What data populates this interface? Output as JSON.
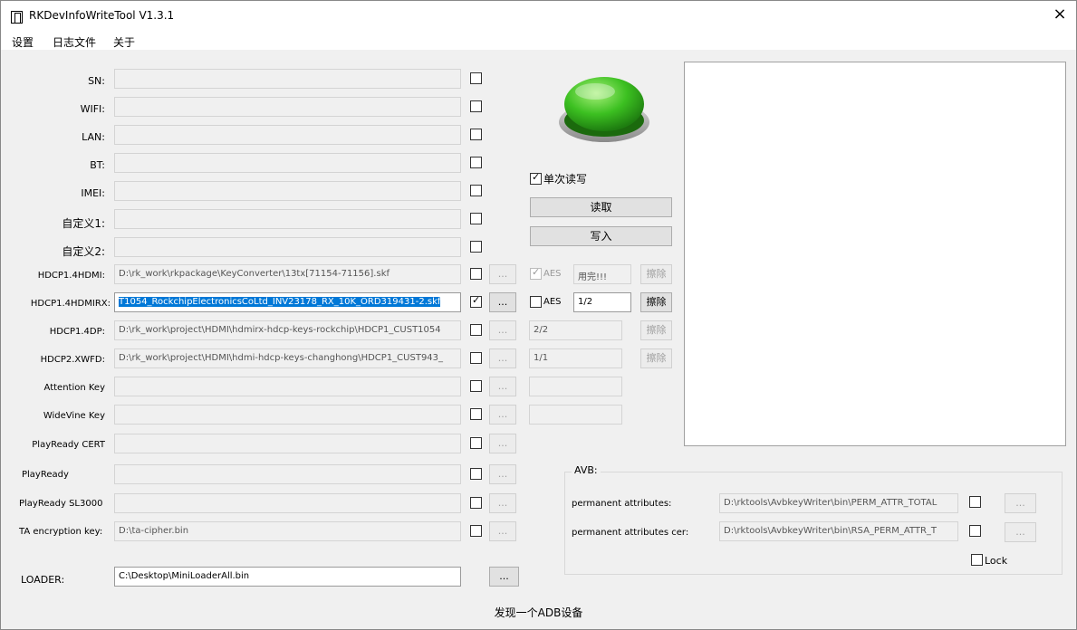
{
  "window": {
    "title": "RKDevInfoWriteTool V1.3.1",
    "close_label": "×"
  },
  "menu": {
    "settings": "设置",
    "log": "日志文件",
    "about": "关于"
  },
  "fields": {
    "sn": {
      "label": "SN:",
      "value": ""
    },
    "wifi": {
      "label": "WIFI:",
      "value": ""
    },
    "lan": {
      "label": "LAN:",
      "value": ""
    },
    "bt": {
      "label": "BT:",
      "value": ""
    },
    "imei": {
      "label": "IMEI:",
      "value": ""
    },
    "custom1": {
      "label": "自定义1:",
      "value": ""
    },
    "custom2": {
      "label": "自定义2:",
      "value": ""
    },
    "hdcp14hdmi": {
      "label": "HDCP1.4HDMI:",
      "value": "D:\\rk_work\\rkpackage\\KeyConverter\\13tx[71154-71156].skf"
    },
    "hdcp14hdmirx": {
      "label": "HDCP1.4HDMIRX:",
      "value": "T1054_RockchipElectronicsCoLtd_INV23178_RX_10K_ORD319431-2.skf"
    },
    "hdcp14dp": {
      "label": "HDCP1.4DP:",
      "value": "D:\\rk_work\\project\\HDMI\\hdmirx-hdcp-keys-rockchip\\HDCP1_CUST1054"
    },
    "hdcp2xwfd": {
      "label": "HDCP2.XWFD:",
      "value": "D:\\rk_work\\project\\HDMI\\hdmi-hdcp-keys-changhong\\HDCP1_CUST943_"
    },
    "attention": {
      "label": "Attention Key",
      "value": ""
    },
    "widevine": {
      "label": "WideVine Key",
      "value": ""
    },
    "playready_cert": {
      "label": "PlayReady CERT",
      "value": ""
    },
    "playready": {
      "label": "PlayReady",
      "value": ""
    },
    "playready_sl3000": {
      "label": "PlayReady SL3000",
      "value": ""
    },
    "ta_key": {
      "label": "TA encryption key:",
      "value": "D:\\ta-cipher.bin"
    },
    "loader": {
      "label": "LOADER:",
      "value": "C:\\Desktop\\MiniLoaderAll.bin"
    }
  },
  "browse_label": "...",
  "controls": {
    "single_rw": "单次读写",
    "read": "读取",
    "write": "写入"
  },
  "aes": {
    "row1": {
      "label": "AES",
      "status": "用完!!!",
      "erase": "擦除"
    },
    "row2": {
      "label": "AES",
      "status": "1/2",
      "erase": "擦除"
    },
    "row3": {
      "status": "2/2",
      "erase": "擦除"
    },
    "row4": {
      "status": "1/1",
      "erase": "擦除"
    }
  },
  "avb": {
    "title": "AVB:",
    "perm_attr": {
      "label": "permanent attributes:",
      "value": "D:\\rktools\\AvbkeyWriter\\bin\\PERM_ATTR_TOTAL"
    },
    "perm_attr_cer": {
      "label": "permanent attributes cer:",
      "value": "D:\\rktools\\AvbkeyWriter\\bin\\RSA_PERM_ATTR_T"
    },
    "lock": "Lock"
  },
  "status": "发现一个ADB设备",
  "colors": {
    "button_green": "#3cc021",
    "selection": "#0078d7"
  }
}
